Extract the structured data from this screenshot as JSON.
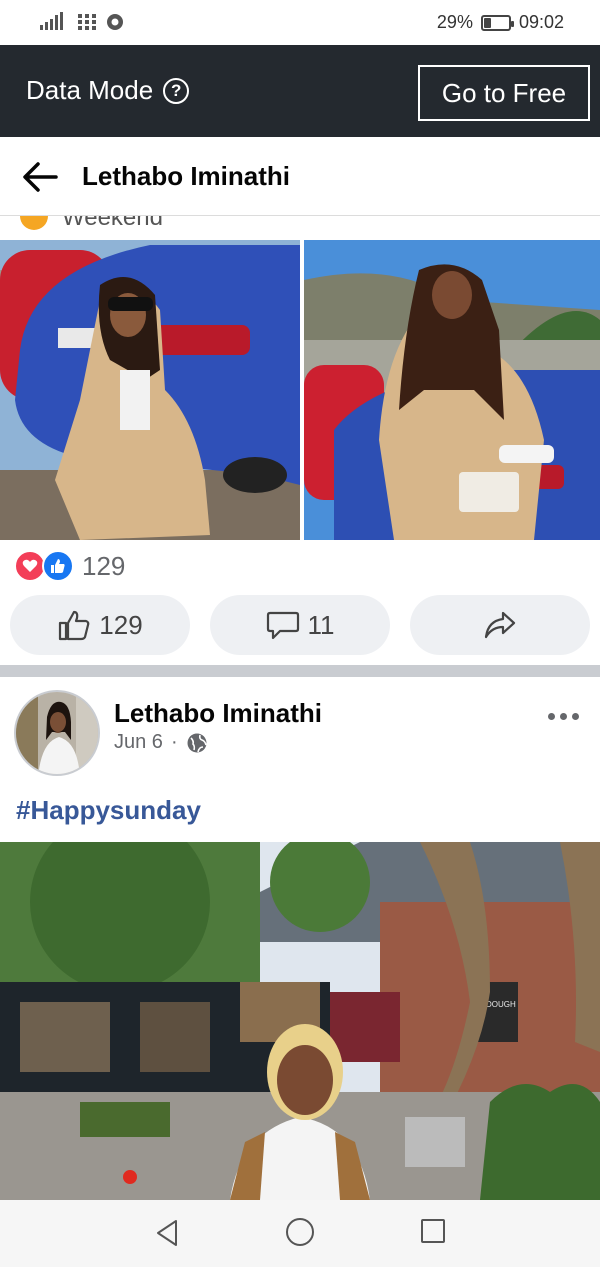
{
  "status_bar": {
    "battery_percent": "29%",
    "battery_level": 0.29,
    "time": "09:02",
    "icons": [
      "signal-icon",
      "app-grid-icon",
      "chrome-icon"
    ]
  },
  "data_bar": {
    "label": "Data Mode",
    "help_glyph": "?",
    "go_free_label": "Go to Free"
  },
  "header": {
    "title": "Lethabo Iminathi"
  },
  "previous_post": {
    "partial_text": "Weekend",
    "reactions_count": "129",
    "like_count": "129",
    "comment_count": "11"
  },
  "post": {
    "author": "Lethabo Iminathi",
    "date": "Jun 6",
    "separator": "·",
    "text": "#Happysunday",
    "photo_sign": "DOUGH"
  },
  "colors": {
    "data_bar": "#24292f",
    "link_blue": "#385898",
    "like_blue": "#1877f2",
    "love_red": "#f33e58",
    "pill_bg": "#eef0f3"
  }
}
